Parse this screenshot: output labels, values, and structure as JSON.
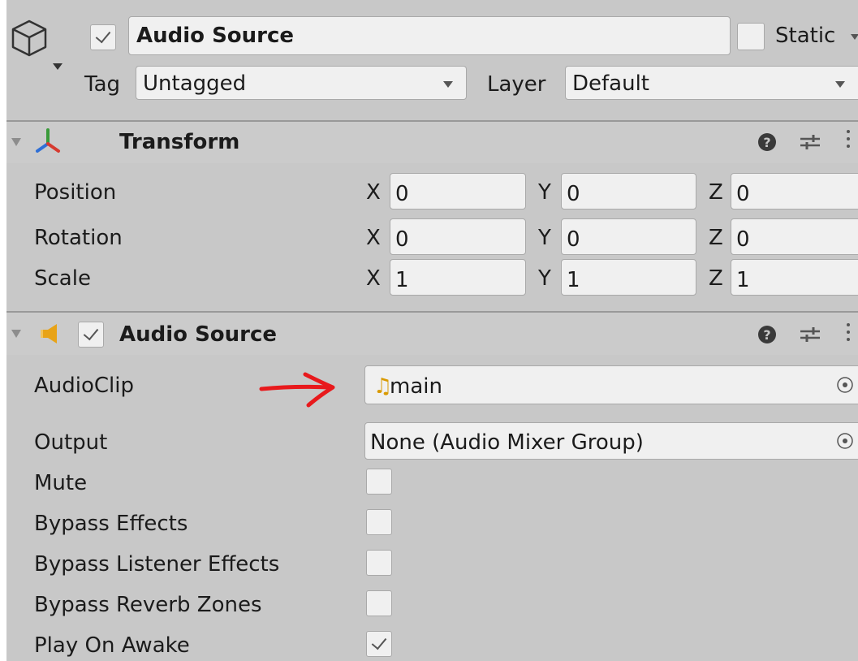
{
  "header": {
    "active": true,
    "name": "Audio Source",
    "static_label": "Static",
    "tag_label": "Tag",
    "tag_value": "Untagged",
    "layer_label": "Layer",
    "layer_value": "Default"
  },
  "transform": {
    "title": "Transform",
    "rows": [
      {
        "label": "Position",
        "x": "0",
        "y": "0",
        "z": "0"
      },
      {
        "label": "Rotation",
        "x": "0",
        "y": "0",
        "z": "0"
      },
      {
        "label": "Scale",
        "x": "1",
        "y": "1",
        "z": "1"
      }
    ],
    "axes": {
      "x": "X",
      "y": "Y",
      "z": "Z"
    }
  },
  "audio_source": {
    "title": "Audio Source",
    "enabled": true,
    "audioclip_label": "AudioClip",
    "audioclip_value": "main",
    "output_label": "Output",
    "output_value": "None (Audio Mixer Group)",
    "mute_label": "Mute",
    "mute": false,
    "bypass_effects_label": "Bypass Effects",
    "bypass_effects": false,
    "bypass_listener_label": "Bypass Listener Effects",
    "bypass_listener": false,
    "bypass_reverb_label": "Bypass Reverb Zones",
    "bypass_reverb": false,
    "play_on_awake_label": "Play On Awake",
    "play_on_awake": true
  },
  "colors": {
    "panel_bg": "#c8c8c8",
    "field_bg": "#f0f0f0",
    "annotation_arrow": "#e8191c",
    "audio_icon": "#e8a317",
    "music_note": "#d99a00"
  },
  "icons": {
    "gameobject": "cube-icon",
    "transform": "transform-axes-icon",
    "audio": "speaker-icon",
    "help": "help-icon",
    "presets": "sliders-icon",
    "menu": "kebab-menu-icon",
    "object_picker": "target-picker-icon",
    "dropdown": "chevron-down-icon"
  }
}
